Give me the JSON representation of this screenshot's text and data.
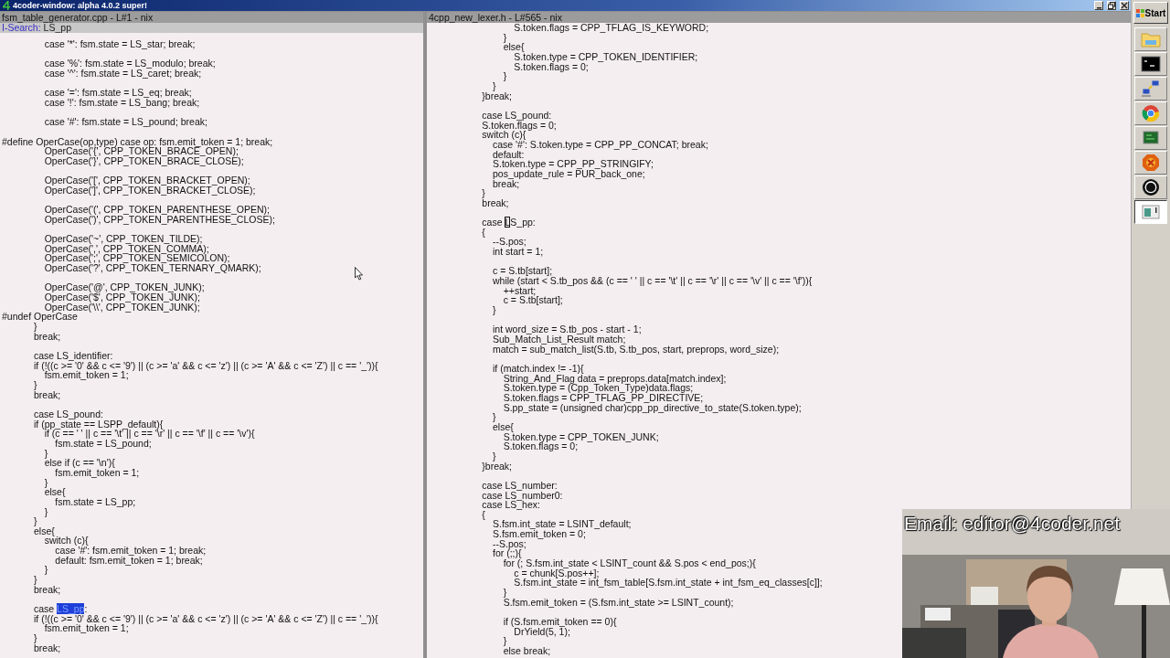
{
  "window": {
    "title": "4coder-window: alpha 4.0.2 super!"
  },
  "panels": [
    {
      "file_bar": "fsm_table_generator.cpp - L#1 - nix",
      "search": {
        "label": "I-Search:",
        "value": "LS_pp"
      },
      "code": [
        [
          "                case '*': fsm.state = LS_star; break;"
        ],
        [
          "                case '%': fsm.state = LS_modulo; break;",
          "                case '^': fsm.state = LS_caret; break;"
        ],
        [
          "                case '=': fsm.state = LS_eq; break;",
          "                case '!': fsm.state = LS_bang; break;"
        ],
        [
          "                case '#': fsm.state = LS_pound; break;"
        ],
        [
          "#define OperCase(op,type) case op: fsm.emit_token = 1; break;",
          "                OperCase('{', CPP_TOKEN_BRACE_OPEN);",
          "                OperCase('}', CPP_TOKEN_BRACE_CLOSE);"
        ],
        [
          "                OperCase('[', CPP_TOKEN_BRACKET_OPEN);",
          "                OperCase(']', CPP_TOKEN_BRACKET_CLOSE);"
        ],
        [
          "                OperCase('(', CPP_TOKEN_PARENTHESE_OPEN);",
          "                OperCase(')', CPP_TOKEN_PARENTHESE_CLOSE);"
        ],
        [
          "                OperCase('~', CPP_TOKEN_TILDE);",
          "                OperCase(',', CPP_TOKEN_COMMA);",
          "                OperCase(';', CPP_TOKEN_SEMICOLON);",
          "                OperCase('?', CPP_TOKEN_TERNARY_QMARK);"
        ],
        [
          "                OperCase('@', CPP_TOKEN_JUNK);",
          "                OperCase('$', CPP_TOKEN_JUNK);",
          "                OperCase('\\\\', CPP_TOKEN_JUNK);",
          "#undef OperCase",
          "            }",
          "            break;"
        ],
        [
          "            case LS_identifier:",
          "            if (!((c >= '0' && c <= '9') || (c >= 'a' && c <= 'z') || (c >= 'A' && c <= 'Z') || c == '_')){",
          "                fsm.emit_token = 1;",
          "            }",
          "            break;"
        ],
        [
          "            case LS_pound:",
          "            if (pp_state == LSPP_default){",
          "                if (c == ' ' || c == '\\t' || c == '\\r' || c == '\\f' || c == '\\v'){",
          "                    fsm.state = LS_pound;",
          "                }",
          "                else if (c == '\\n'){",
          "                    fsm.emit_token = 1;",
          "                }",
          "                else{",
          "                    fsm.state = LS_pp;",
          "                }",
          "            }",
          "            else{",
          "                switch (c){",
          "                    case '#': fsm.emit_token = 1; break;",
          "                    default: fsm.emit_token = 1; break;",
          "                }",
          "            }",
          "            break;"
        ],
        [
          {
            "kind": "match",
            "before": "            case ",
            "mark": "LS_pp",
            "after": ":"
          },
          "            if (!((c >= '0' && c <= '9') || (c >= 'a' && c <= 'z') || (c >= 'A' && c <= 'Z') || c == '_')){",
          "                fsm.emit_token = 1;",
          "            }",
          "            break;"
        ]
      ]
    },
    {
      "file_bar": "4cpp_new_lexer.h - L#565 - nix",
      "code": [
        [
          "                                S.token.flags = CPP_TFLAG_IS_KEYWORD;",
          "                            }",
          "                            else{",
          "                                S.token.type = CPP_TOKEN_IDENTIFIER;",
          "                                S.token.flags = 0;",
          "                            }",
          "                        }",
          "                    }break;"
        ],
        [
          "                    case LS_pound:",
          "                    S.token.flags = 0;",
          "                    switch (c){",
          "                        case '#': S.token.type = CPP_PP_CONCAT; break;",
          "                        default:",
          "                        S.token.type = CPP_PP_STRINGIFY;",
          "                        pos_update_rule = PUR_back_one;",
          "                        break;",
          "                    }",
          "                    break;"
        ],
        [
          {
            "kind": "cursor",
            "before": "                    case ",
            "mark": "L",
            "after": "S_pp:"
          },
          "                    {",
          "                        --S.pos;",
          "                        int start = 1;"
        ],
        [
          "                        c = S.tb[start];",
          "                        while (start < S.tb_pos && (c == ' ' || c == '\\t' || c == '\\r' || c == '\\v' || c == '\\f')){",
          "                            ++start;",
          "                            c = S.tb[start];",
          "                        }"
        ],
        [
          "                        int word_size = S.tb_pos - start - 1;",
          "                        Sub_Match_List_Result match;",
          "                        match = sub_match_list(S.tb, S.tb_pos, start, preprops, word_size);"
        ],
        [
          "                        if (match.index != -1){",
          "                            String_And_Flag data = preprops.data[match.index];",
          "                            S.token.type = (Cpp_Token_Type)data.flags;",
          "                            S.token.flags = CPP_TFLAG_PP_DIRECTIVE;",
          "                            S.pp_state = (unsigned char)cpp_pp_directive_to_state(S.token.type);",
          "                        }",
          "                        else{",
          "                            S.token.type = CPP_TOKEN_JUNK;",
          "                            S.token.flags = 0;",
          "                        }",
          "                    }break;"
        ],
        [
          "                    case LS_number:",
          "                    case LS_number0:",
          "                    case LS_hex:",
          "                    {",
          "                        S.fsm.int_state = LSINT_default;",
          "                        S.fsm.emit_token = 0;",
          "                        --S.pos;",
          "                        for (;;){",
          "                            for (; S.fsm.int_state < LSINT_count && S.pos < end_pos;){",
          "                                c = chunk[S.pos++];",
          "                                S.fsm.int_state = int_fsm_table[S.fsm.int_state + int_fsm_eq_classes[c]];",
          "                            }",
          "                            S.fsm.emit_token = (S.fsm.int_state >= LSINT_count);"
        ],
        [
          "                            if (S.fsm.emit_token == 0){",
          "                                DrYield(5, 1);",
          "                            }",
          "                            else break;"
        ]
      ]
    }
  ],
  "webcam": {
    "kind": "picture",
    "caption": "Email: editor@4coder.net"
  },
  "taskbar": {
    "start": "Start",
    "items": [
      {
        "kind": "folder",
        "selected": false
      },
      {
        "kind": "terminal",
        "selected": false
      },
      {
        "kind": "network",
        "selected": false
      },
      {
        "kind": "browser",
        "selected": false
      },
      {
        "kind": "board",
        "selected": false
      },
      {
        "kind": "hexagon",
        "selected": false
      },
      {
        "kind": "aperture",
        "selected": false
      },
      {
        "kind": "window",
        "selected": true
      }
    ]
  }
}
